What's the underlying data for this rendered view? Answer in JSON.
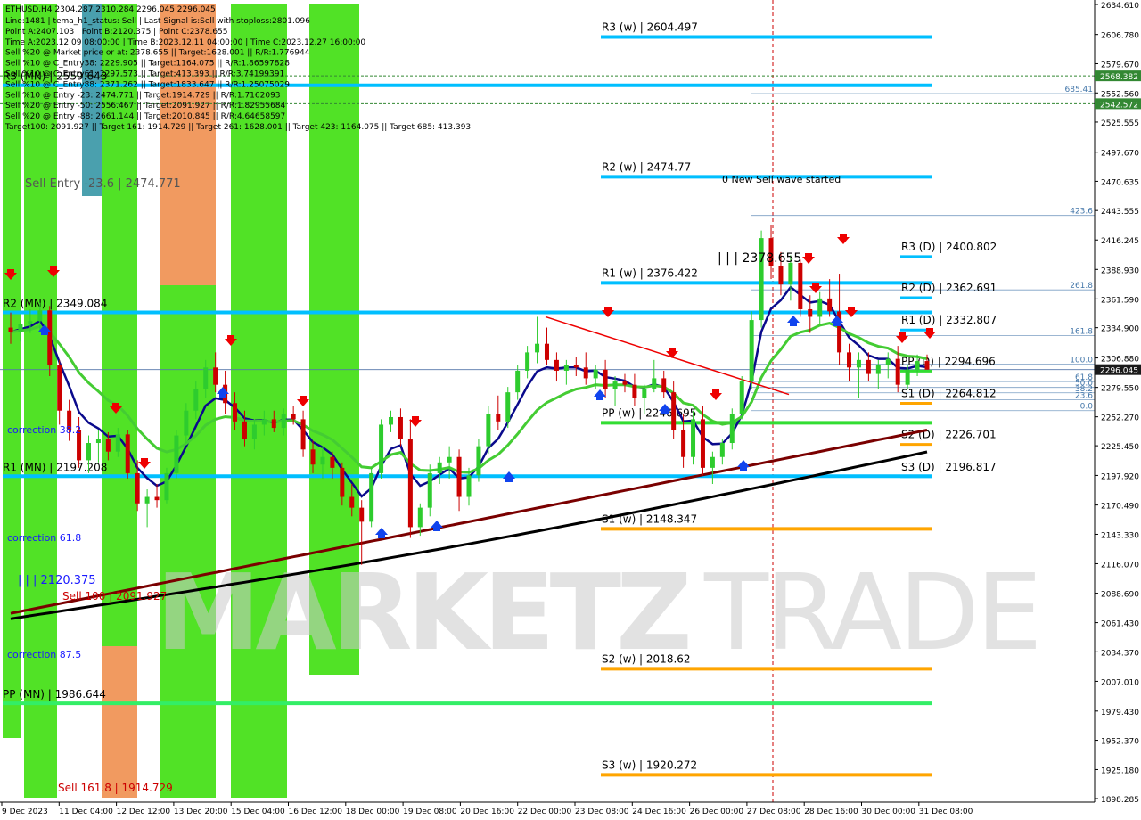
{
  "window": {
    "symbol_line": "ETHUSD,H4  2304.287 2310.284 2296.045 2296.045"
  },
  "info_lines": [
    "Line:1481 | tema_h1_status: Sell | Last Signal is:Sell with stoploss:2801.096",
    "Point A:2407.103 | Point B:2120.375 | Point C:2378.655",
    "Time A:2023.12.09 08:00:00 | Time B:2023.12.11 04:00:00 | Time C:2023.12.27 16:00:00",
    "Sell %20 @ Market price or at: 2378.655 || Target:1628.001 || R/R:1.776944",
    "Sell %10 @ C_Entry38: 2229.905 || Target:1164.075 || R/R:1.86597828",
    "Sell %10 @ C_Entry61: 2297.573 || Target:413.393 || R/R:3.74199391",
    "Sell %10 @ C_Entry88: 2371.262 || Target:1833.647 || R/R:1.25075029",
    "Sell %10 @ Entry -23: 2474.771 || Target:1914.729 || R/R:1.7162093",
    "Sell %20 @ Entry -50: 2556.467 || Target:2091.927 || R/R:1.82955684",
    "Sell %20 @ Entry -88: 2661.144 || Target:2010.845 || R/R:4.64658597",
    "Target100: 2091.927 || Target 161: 1914.729 || Target 261: 1628.001 || Target 423: 1164.075 || Target 685: 413.393"
  ],
  "colors": {
    "bull_candle": "#2ecc2e",
    "bear_candle": "#cc0000",
    "pivot_blue": "#00bfff",
    "support_orange": "#ffa500",
    "green_zone": "#33dd00",
    "orange_zone": "#ee8844",
    "teal_zone": "#2a8fa0",
    "ma_navy": "#0a0a8c",
    "ma_green": "#44cc33",
    "ma_maroon": "#7a0000",
    "ma_black": "#000000",
    "price_box": "#1a1a1a",
    "green_box": "#338833"
  },
  "chart_data": {
    "type": "candlestick",
    "symbol": "ETHUSD",
    "timeframe": "H4",
    "ohlc_current": {
      "open": 2304.287,
      "high": 2310.284,
      "low": 2296.045,
      "close": 2296.045
    },
    "ylim": [
      1898.285,
      2634.61
    ],
    "y_ticks": [
      "2634.610",
      "2606.780",
      "2579.670",
      "2552.560",
      "2525.555",
      "2497.670",
      "2470.635",
      "2443.555",
      "2416.245",
      "2388.930",
      "2361.590",
      "2334.900",
      "2306.880",
      "2279.550",
      "2252.270",
      "2225.450",
      "2197.920",
      "2170.490",
      "2143.330",
      "2116.070",
      "2088.690",
      "2061.430",
      "2034.370",
      "2007.010",
      "1979.430",
      "1952.370",
      "1925.180",
      "1898.285"
    ],
    "y_tick_values": [
      2634.61,
      2606.78,
      2579.67,
      2552.56,
      2525.555,
      2497.67,
      2470.635,
      2443.555,
      2416.245,
      2388.93,
      2361.59,
      2334.9,
      2306.88,
      2279.55,
      2252.27,
      2225.45,
      2197.92,
      2170.49,
      2143.33,
      2116.07,
      2088.69,
      2061.43,
      2034.37,
      2007.01,
      1979.43,
      1952.37,
      1925.18,
      1898.285
    ],
    "x_ticks": [
      "9 Dec 2023",
      "11 Dec 04:00",
      "12 Dec 12:00",
      "13 Dec 20:00",
      "15 Dec 04:00",
      "16 Dec 12:00",
      "18 Dec 00:00",
      "19 Dec 08:00",
      "20 Dec 16:00",
      "22 Dec 00:00",
      "23 Dec 08:00",
      "24 Dec 16:00",
      "26 Dec 00:00",
      "27 Dec 08:00",
      "28 Dec 16:00",
      "30 Dec 00:00",
      "31 Dec 08:00"
    ],
    "current_price": "2296.045",
    "price_tags": [
      {
        "label": "2568.382",
        "value": 2568.382,
        "color": "#338833"
      },
      {
        "label": "2542.572",
        "value": 2542.572,
        "color": "#338833"
      },
      {
        "label": "2296.045",
        "value": 2296.045,
        "color": "#1a1a1a"
      }
    ],
    "weekly_pivots": [
      {
        "label": "R3 (w) | 2604.497",
        "value": 2604.497,
        "color": "#00bfff"
      },
      {
        "label": "R2 (w) | 2474.77",
        "value": 2474.77,
        "color": "#00bfff"
      },
      {
        "label": "R1 (w) | 2376.422",
        "value": 2376.422,
        "color": "#00bfff"
      },
      {
        "label": "PP (w) | 2246.695",
        "value": 2246.695,
        "color": "#33dd33"
      },
      {
        "label": "S1 (w) | 2148.347",
        "value": 2148.347,
        "color": "#ffa500"
      },
      {
        "label": "S2 (w) | 2018.62",
        "value": 2018.62,
        "color": "#ffa500"
      },
      {
        "label": "S3 (w) | 1920.272",
        "value": 1920.272,
        "color": "#ffa500"
      }
    ],
    "daily_pivots": [
      {
        "label": "R3 (D) | 2400.802",
        "value": 2400.802,
        "color": "#00bfff"
      },
      {
        "label": "R2 (D) | 2362.691",
        "value": 2362.691,
        "color": "#00bfff"
      },
      {
        "label": "R1 (D) | 2332.807",
        "value": 2332.807,
        "color": "#00bfff"
      },
      {
        "label": "PP (D) | 2294.696",
        "value": 2294.696,
        "color": "#33dd33"
      },
      {
        "label": "S1 (D) | 2264.812",
        "value": 2264.812,
        "color": "#ffa500"
      },
      {
        "label": "S2 (D) | 2226.701",
        "value": 2226.701,
        "color": "#ffa500"
      },
      {
        "label": "S3 (D) | 2196.817",
        "value": 2196.817,
        "color": "#00bfff"
      }
    ],
    "monthly_pivots": [
      {
        "label": "R3 (MN) | 2559.643",
        "value": 2559.643,
        "color": "#00bfff"
      },
      {
        "label": "R2 (MN) | 2349.084",
        "value": 2349.084,
        "color": "#00bfff"
      },
      {
        "label": "R1 (MN) | 2197.208",
        "value": 2197.208,
        "color": "#00bfff"
      },
      {
        "label": "PP (MN) | 1986.644",
        "value": 1986.644,
        "color": "#33ee66"
      }
    ],
    "fib_levels": [
      {
        "label": "685.41",
        "value": 2552.0
      },
      {
        "label": "423.6",
        "value": 2439.0
      },
      {
        "label": "261.8",
        "value": 2370.0
      },
      {
        "label": "161.8",
        "value": 2327.5
      },
      {
        "label": "100.0",
        "value": 2301.0
      },
      {
        "label": "61.8",
        "value": 2285.0
      },
      {
        "label": "50.0",
        "value": 2279.5
      },
      {
        "label": "38.2",
        "value": 2274.5
      },
      {
        "label": "23.6",
        "value": 2268.0
      },
      {
        "label": "0.0",
        "value": 2258.0
      }
    ],
    "annotations": [
      {
        "text": "Sell Entry -23.6 | 2474.771",
        "color": "#555555"
      },
      {
        "text": "0 New Sell wave started",
        "color": "#000000"
      },
      {
        "text": "| | | 2378.655",
        "color": "#000000"
      },
      {
        "text": "correction 38.2",
        "color": "#1a1aff"
      },
      {
        "text": "correction 61.8",
        "color": "#1a1aff"
      },
      {
        "text": "correction 87.5",
        "color": "#1a1aff"
      },
      {
        "text": "| | | 2120.375",
        "color": "#1a1aff"
      },
      {
        "text": "Sell 100 | 2091.927",
        "color": "#cc0000"
      },
      {
        "text": "Sell 161.8 | 1914.729",
        "color": "#cc0000"
      }
    ],
    "candles": [
      [
        2335,
        2349,
        2320,
        2331
      ],
      [
        2331,
        2342,
        2322,
        2338
      ],
      [
        2338,
        2352,
        2330,
        2341
      ],
      [
        2341,
        2358,
        2332,
        2351
      ],
      [
        2351,
        2355,
        2290,
        2300
      ],
      [
        2300,
        2305,
        2245,
        2258
      ],
      [
        2258,
        2268,
        2230,
        2240
      ],
      [
        2240,
        2252,
        2205,
        2212
      ],
      [
        2212,
        2235,
        2200,
        2228
      ],
      [
        2228,
        2240,
        2210,
        2232
      ],
      [
        2232,
        2238,
        2212,
        2220
      ],
      [
        2220,
        2242,
        2215,
        2236
      ],
      [
        2236,
        2240,
        2195,
        2200
      ],
      [
        2200,
        2212,
        2165,
        2172
      ],
      [
        2172,
        2185,
        2150,
        2178
      ],
      [
        2178,
        2190,
        2168,
        2175
      ],
      [
        2175,
        2205,
        2172,
        2200
      ],
      [
        2200,
        2240,
        2195,
        2235
      ],
      [
        2235,
        2265,
        2228,
        2258
      ],
      [
        2258,
        2285,
        2250,
        2278
      ],
      [
        2278,
        2305,
        2270,
        2298
      ],
      [
        2298,
        2312,
        2275,
        2282
      ],
      [
        2282,
        2295,
        2255,
        2265
      ],
      [
        2265,
        2275,
        2240,
        2248
      ],
      [
        2248,
        2258,
        2225,
        2232
      ],
      [
        2232,
        2250,
        2222,
        2245
      ],
      [
        2245,
        2258,
        2235,
        2250
      ],
      [
        2250,
        2258,
        2238,
        2242
      ],
      [
        2242,
        2260,
        2235,
        2255
      ],
      [
        2255,
        2262,
        2245,
        2250
      ],
      [
        2250,
        2258,
        2215,
        2222
      ],
      [
        2222,
        2230,
        2200,
        2208
      ],
      [
        2208,
        2225,
        2195,
        2215
      ],
      [
        2215,
        2220,
        2195,
        2205
      ],
      [
        2205,
        2210,
        2170,
        2178
      ],
      [
        2178,
        2190,
        2160,
        2168
      ],
      [
        2168,
        2175,
        2115,
        2155
      ],
      [
        2155,
        2205,
        2150,
        2200
      ],
      [
        2200,
        2250,
        2195,
        2245
      ],
      [
        2245,
        2258,
        2238,
        2252
      ],
      [
        2252,
        2260,
        2225,
        2232
      ],
      [
        2232,
        2250,
        2140,
        2150
      ],
      [
        2150,
        2172,
        2142,
        2168
      ],
      [
        2168,
        2208,
        2160,
        2200
      ],
      [
        2200,
        2215,
        2190,
        2210
      ],
      [
        2210,
        2225,
        2195,
        2215
      ],
      [
        2215,
        2222,
        2165,
        2178
      ],
      [
        2178,
        2205,
        2170,
        2198
      ],
      [
        2198,
        2232,
        2192,
        2225
      ],
      [
        2225,
        2262,
        2218,
        2255
      ],
      [
        2255,
        2272,
        2240,
        2248
      ],
      [
        2248,
        2280,
        2242,
        2275
      ],
      [
        2275,
        2300,
        2268,
        2295
      ],
      [
        2295,
        2318,
        2288,
        2312
      ],
      [
        2312,
        2345,
        2302,
        2320
      ],
      [
        2320,
        2335,
        2300,
        2305
      ],
      [
        2305,
        2312,
        2285,
        2295
      ],
      [
        2295,
        2305,
        2282,
        2300
      ],
      [
        2300,
        2308,
        2290,
        2298
      ],
      [
        2298,
        2312,
        2282,
        2288
      ],
      [
        2288,
        2300,
        2278,
        2296
      ],
      [
        2296,
        2305,
        2270,
        2278
      ],
      [
        2278,
        2290,
        2262,
        2285
      ],
      [
        2285,
        2292,
        2275,
        2282
      ],
      [
        2282,
        2292,
        2262,
        2270
      ],
      [
        2270,
        2282,
        2255,
        2278
      ],
      [
        2278,
        2305,
        2275,
        2288
      ],
      [
        2288,
        2295,
        2270,
        2275
      ],
      [
        2275,
        2285,
        2232,
        2240
      ],
      [
        2240,
        2255,
        2205,
        2215
      ],
      [
        2215,
        2258,
        2208,
        2250
      ],
      [
        2250,
        2262,
        2198,
        2205
      ],
      [
        2205,
        2220,
        2190,
        2215
      ],
      [
        2215,
        2232,
        2208,
        2228
      ],
      [
        2228,
        2260,
        2222,
        2255
      ],
      [
        2255,
        2290,
        2250,
        2285
      ],
      [
        2285,
        2350,
        2278,
        2342
      ],
      [
        2342,
        2425,
        2335,
        2418
      ],
      [
        2418,
        2430,
        2380,
        2392
      ],
      [
        2392,
        2405,
        2365,
        2375
      ],
      [
        2375,
        2402,
        2360,
        2395
      ],
      [
        2395,
        2398,
        2345,
        2352
      ],
      [
        2352,
        2365,
        2330,
        2345
      ],
      [
        2345,
        2368,
        2338,
        2362
      ],
      [
        2362,
        2380,
        2345,
        2350
      ],
      [
        2350,
        2385,
        2300,
        2312
      ],
      [
        2312,
        2320,
        2285,
        2298
      ],
      [
        2298,
        2312,
        2270,
        2305
      ],
      [
        2305,
        2312,
        2285,
        2292
      ],
      [
        2292,
        2305,
        2278,
        2300
      ],
      [
        2300,
        2312,
        2288,
        2306
      ],
      [
        2306,
        2318,
        2275,
        2282
      ],
      [
        2282,
        2300,
        2278,
        2296
      ],
      [
        2296,
        2310,
        2290,
        2304
      ],
      [
        2304,
        2310,
        2296,
        2296
      ]
    ]
  }
}
